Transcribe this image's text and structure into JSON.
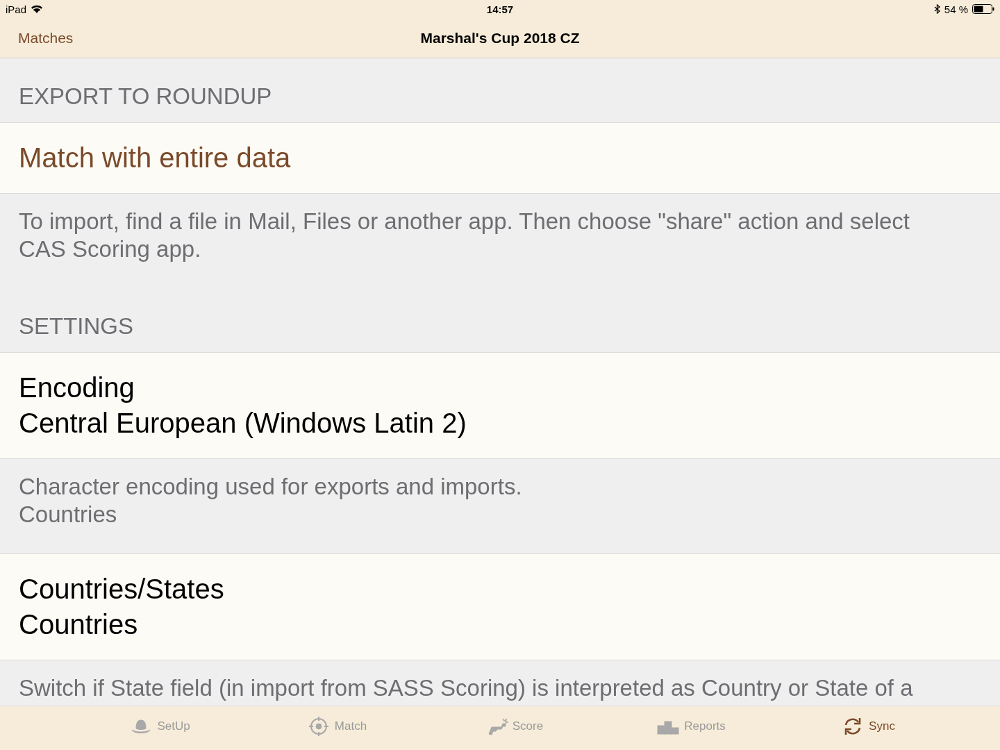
{
  "status_bar": {
    "device": "iPad",
    "time": "14:57",
    "battery": "54 %"
  },
  "nav": {
    "back": "Matches",
    "title": "Marshal's Cup 2018 CZ"
  },
  "sections": [
    {
      "header": "EXPORT TO ROUNDUP",
      "rows": [
        {
          "kind": "action",
          "title": "Match with entire data"
        }
      ],
      "footer": [
        "To import, find a file in Mail, Files or another app. Then choose \"share\" action and select CAS Scoring app."
      ]
    },
    {
      "header": "SETTINGS",
      "rows": [
        {
          "kind": "value",
          "title": "Encoding",
          "value": "Central European (Windows Latin 2)"
        }
      ],
      "footer": [
        "Character encoding used for exports and imports.",
        "Countries"
      ]
    },
    {
      "rows": [
        {
          "kind": "value",
          "title": "Countries/States",
          "value": "Countries"
        }
      ],
      "footer": [
        "Switch if State field (in import from SASS Scoring) is interpreted as Country or State of a"
      ]
    }
  ],
  "tabs": [
    {
      "label": "SetUp",
      "selected": false
    },
    {
      "label": "Match",
      "selected": false
    },
    {
      "label": "Score",
      "selected": false
    },
    {
      "label": "Reports",
      "selected": false
    },
    {
      "label": "Sync",
      "selected": true
    }
  ]
}
